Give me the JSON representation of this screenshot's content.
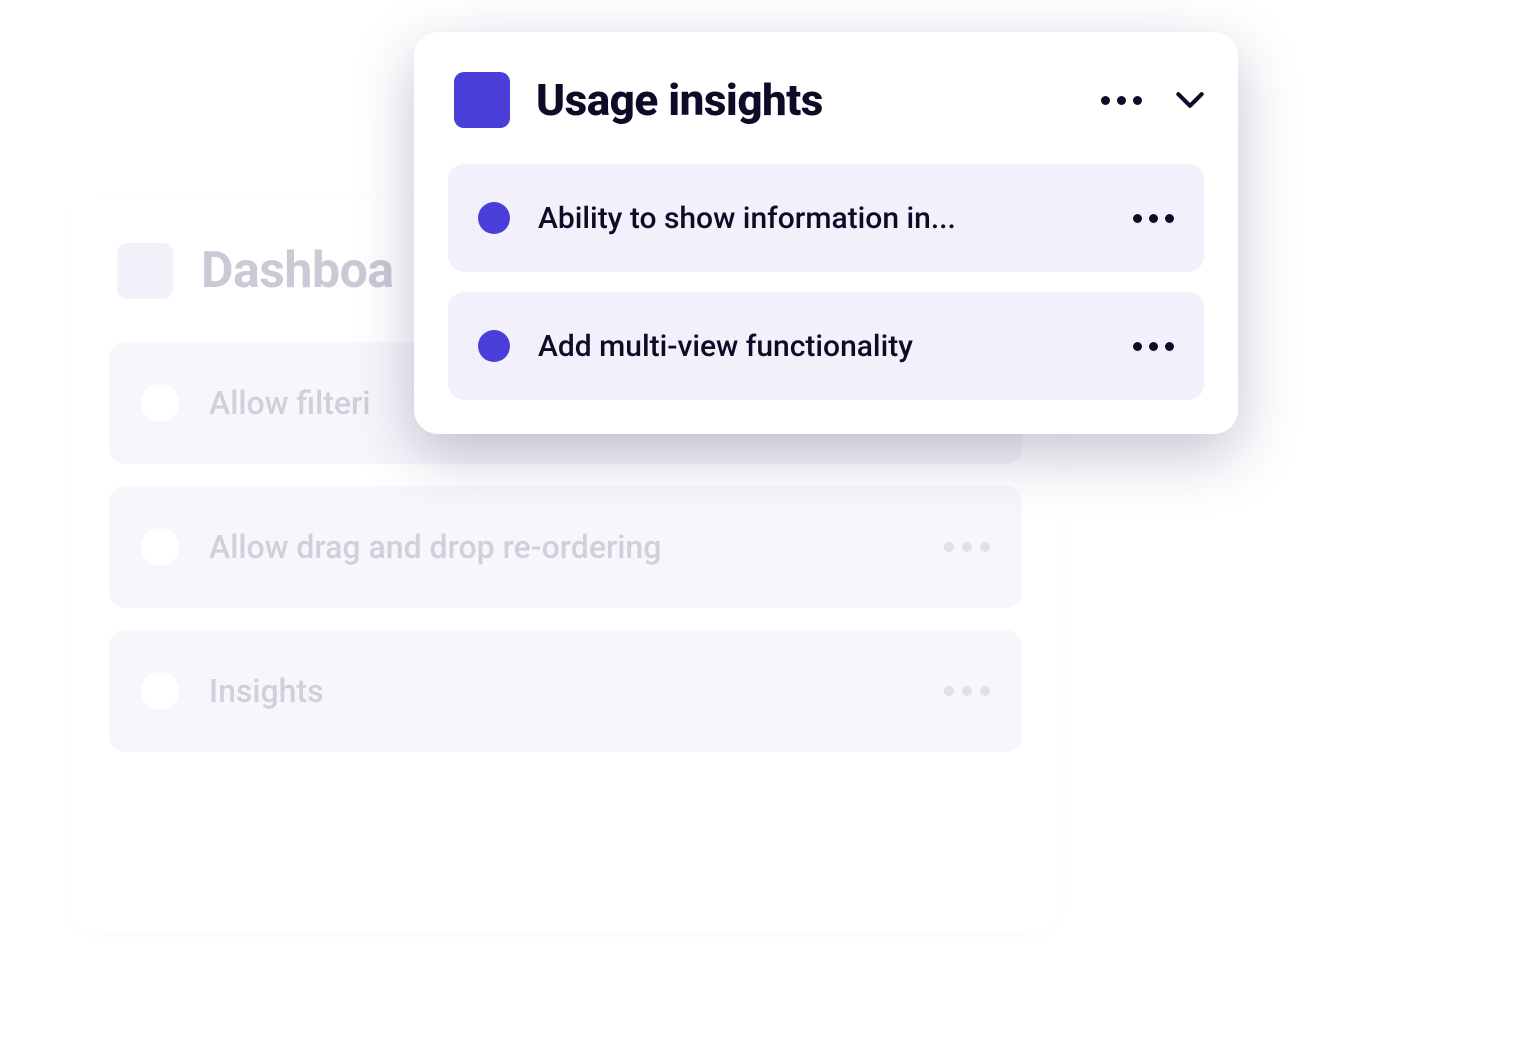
{
  "back_card": {
    "title": "Dashboa",
    "items": [
      {
        "text": "Allow filteri"
      },
      {
        "text": "Allow drag and drop re-ordering"
      },
      {
        "text": "Insights"
      }
    ]
  },
  "front_card": {
    "title": "Usage insights",
    "items": [
      {
        "text": "Ability to show information in..."
      },
      {
        "text": "Add multi-view functionality"
      }
    ]
  },
  "colors": {
    "accent": "#4a3ed9",
    "text_dark": "#0d0b26",
    "text_faded": "#9a97b0",
    "item_bg_front": "#f2f0fb",
    "item_bg_back": "#eeecf7"
  }
}
